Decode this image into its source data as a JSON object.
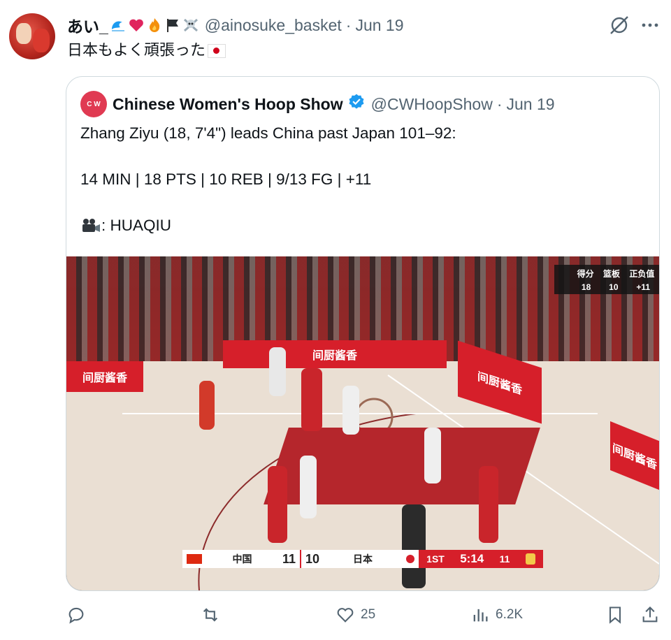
{
  "tweet": {
    "author_name": "あい_",
    "author_handle": "@ainosuke_basket",
    "date": "Jun 19",
    "separator": "·",
    "text": "日本もよく頑張った"
  },
  "quoted": {
    "avatar_text": "C W",
    "author_name": "Chinese Women's Hoop Show",
    "author_handle": "@CWHoopShow",
    "date": "Jun 19",
    "separator": "·",
    "line1": "Zhang Ziyu (18, 7'4\") leads China past Japan 101–92:",
    "line2": "14 MIN | 18 PTS | 10 REB | 9/13 FG | +11",
    "line3": ": HUAQIU"
  },
  "video": {
    "stats_overlay": {
      "label_cols": [
        "得分",
        "篮板",
        "正负值"
      ],
      "values": [
        "18",
        "10",
        "+11"
      ]
    },
    "scoreboard": {
      "team1": "中国",
      "score1": "11",
      "score2": "10",
      "team2": "日本",
      "period": "1ST",
      "clock": "5:14",
      "shot_clock": "11"
    },
    "ads": [
      "间厨酱香",
      "间厨酱香",
      "间厨酱香",
      "间厨酱香"
    ]
  },
  "actions": {
    "likes": "25",
    "views": "6.2K"
  },
  "colors": {
    "accent": "#1d9bf0",
    "muted": "#536471",
    "china_red": "#d61f2a"
  }
}
